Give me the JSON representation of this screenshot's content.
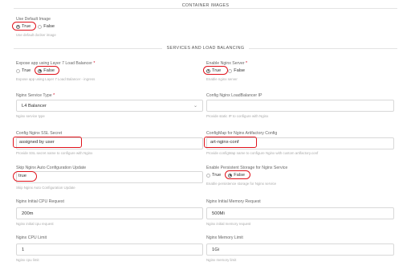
{
  "sections": {
    "container_images": "CONTAINER IMAGES",
    "services_lb": "SERVICES AND LOAD BALANCING"
  },
  "default_image": {
    "label": "Use Default Image",
    "opt_true": "True",
    "opt_false": "False",
    "help": "Use default docker image"
  },
  "expose_l7": {
    "label": "Expose app using Layer 7 Load Balancer",
    "required": "*",
    "opt_true": "True",
    "opt_false": "False",
    "help": "Expose app using Layer 7 Load Balancer - ingress"
  },
  "enable_nginx": {
    "label": "Enable Nginx Server",
    "required": "*",
    "opt_true": "True",
    "opt_false": "False",
    "help": "Enable nginx server"
  },
  "service_type": {
    "label": "Nginx Service Type",
    "required": "*",
    "value": "L4 Balancer",
    "help": "Nginx service type"
  },
  "lb_ip": {
    "label": "Config Nginx LoadBalancer IP",
    "value": "",
    "help": "Provide static IP to configure with Nginx"
  },
  "ssl_secret": {
    "label": "Config Nginx SSL Secret",
    "value": "assigned by user",
    "help": "Provide SSL secret name to configure with Nginx"
  },
  "configmap": {
    "label": "ConfigMap for Nginx Artifactory Config",
    "annotation": "Text",
    "value": "art-nginx-conf",
    "help": "Provide configMap name to configure Nginx with custom artifactory.conf"
  },
  "skip_update": {
    "label": "Skip Nginx Auto Configuration Update",
    "value": "true",
    "help": "Skip Nginx Auto Configuration Update"
  },
  "persistent": {
    "label": "Enable Persistent Storage for Nginx Service",
    "opt_true": "True",
    "opt_false": "False",
    "help": "Enable persistence storage for Nginx service"
  },
  "cpu_request": {
    "label": "Nginx Initial CPU Request",
    "value": "200m",
    "help": "Nginx initial cpu request"
  },
  "mem_request": {
    "label": "Nginx Initial Memory Request",
    "value": "500Mi",
    "help": "Nginx initial memory request"
  },
  "cpu_limit": {
    "label": "Nginx CPU Limit",
    "value": "1",
    "help": "Nginx cpu limit"
  },
  "mem_limit": {
    "label": "Nginx Memory Limit",
    "value": "1Gi",
    "help": "Nginx memory limit"
  }
}
